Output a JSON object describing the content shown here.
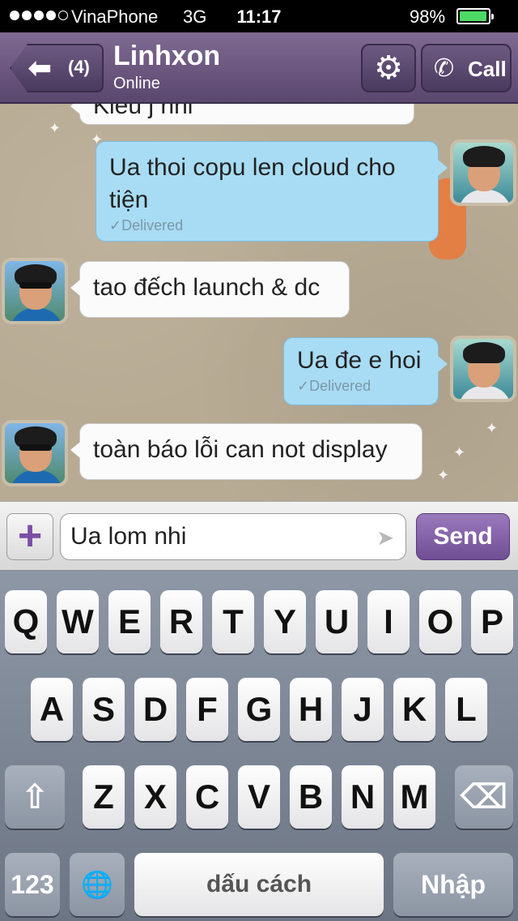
{
  "status_bar": {
    "signal_on": 4,
    "signal_total": 5,
    "carrier": "VinaPhone",
    "network": "3G",
    "time": "11:17",
    "battery_percent": "98%",
    "battery_level": 0.98,
    "battery_color": "#4cd964"
  },
  "nav": {
    "back_icon": "back-arrow-icon",
    "back_count": "(4)",
    "contact_name": "Linhxon",
    "contact_status": "Online",
    "settings_icon": "gear-icon",
    "call_icon": "phone-icon",
    "call_label": "Call",
    "accent_color": "#6b5680"
  },
  "messages": [
    {
      "direction": "in",
      "text": "Kieu j nhi",
      "partial": true
    },
    {
      "direction": "out",
      "text": "Ua thoi copu len cloud cho tiện",
      "status": "Delivered"
    },
    {
      "direction": "in",
      "text": "tao đếch launch & dc"
    },
    {
      "direction": "out",
      "text": "Ua đe e hoi",
      "status": "Delivered"
    },
    {
      "direction": "in",
      "text": "toàn báo lỗi can not display"
    }
  ],
  "composer": {
    "attach_icon": "plus-icon",
    "input_value": "Ua lom nhi",
    "location_icon": "location-arrow-icon",
    "send_label": "Send",
    "send_color": "#7d5aa3"
  },
  "keyboard": {
    "row1": [
      "Q",
      "W",
      "E",
      "R",
      "T",
      "Y",
      "U",
      "I",
      "O",
      "P"
    ],
    "row2": [
      "A",
      "S",
      "D",
      "F",
      "G",
      "H",
      "J",
      "K",
      "L"
    ],
    "row3": [
      "Z",
      "X",
      "C",
      "V",
      "B",
      "N",
      "M"
    ],
    "shift_icon": "shift-icon",
    "delete_icon": "delete-icon",
    "numbers_label": "123",
    "globe_icon": "globe-icon",
    "space_label": "dấu cách",
    "return_label": "Nhập"
  }
}
